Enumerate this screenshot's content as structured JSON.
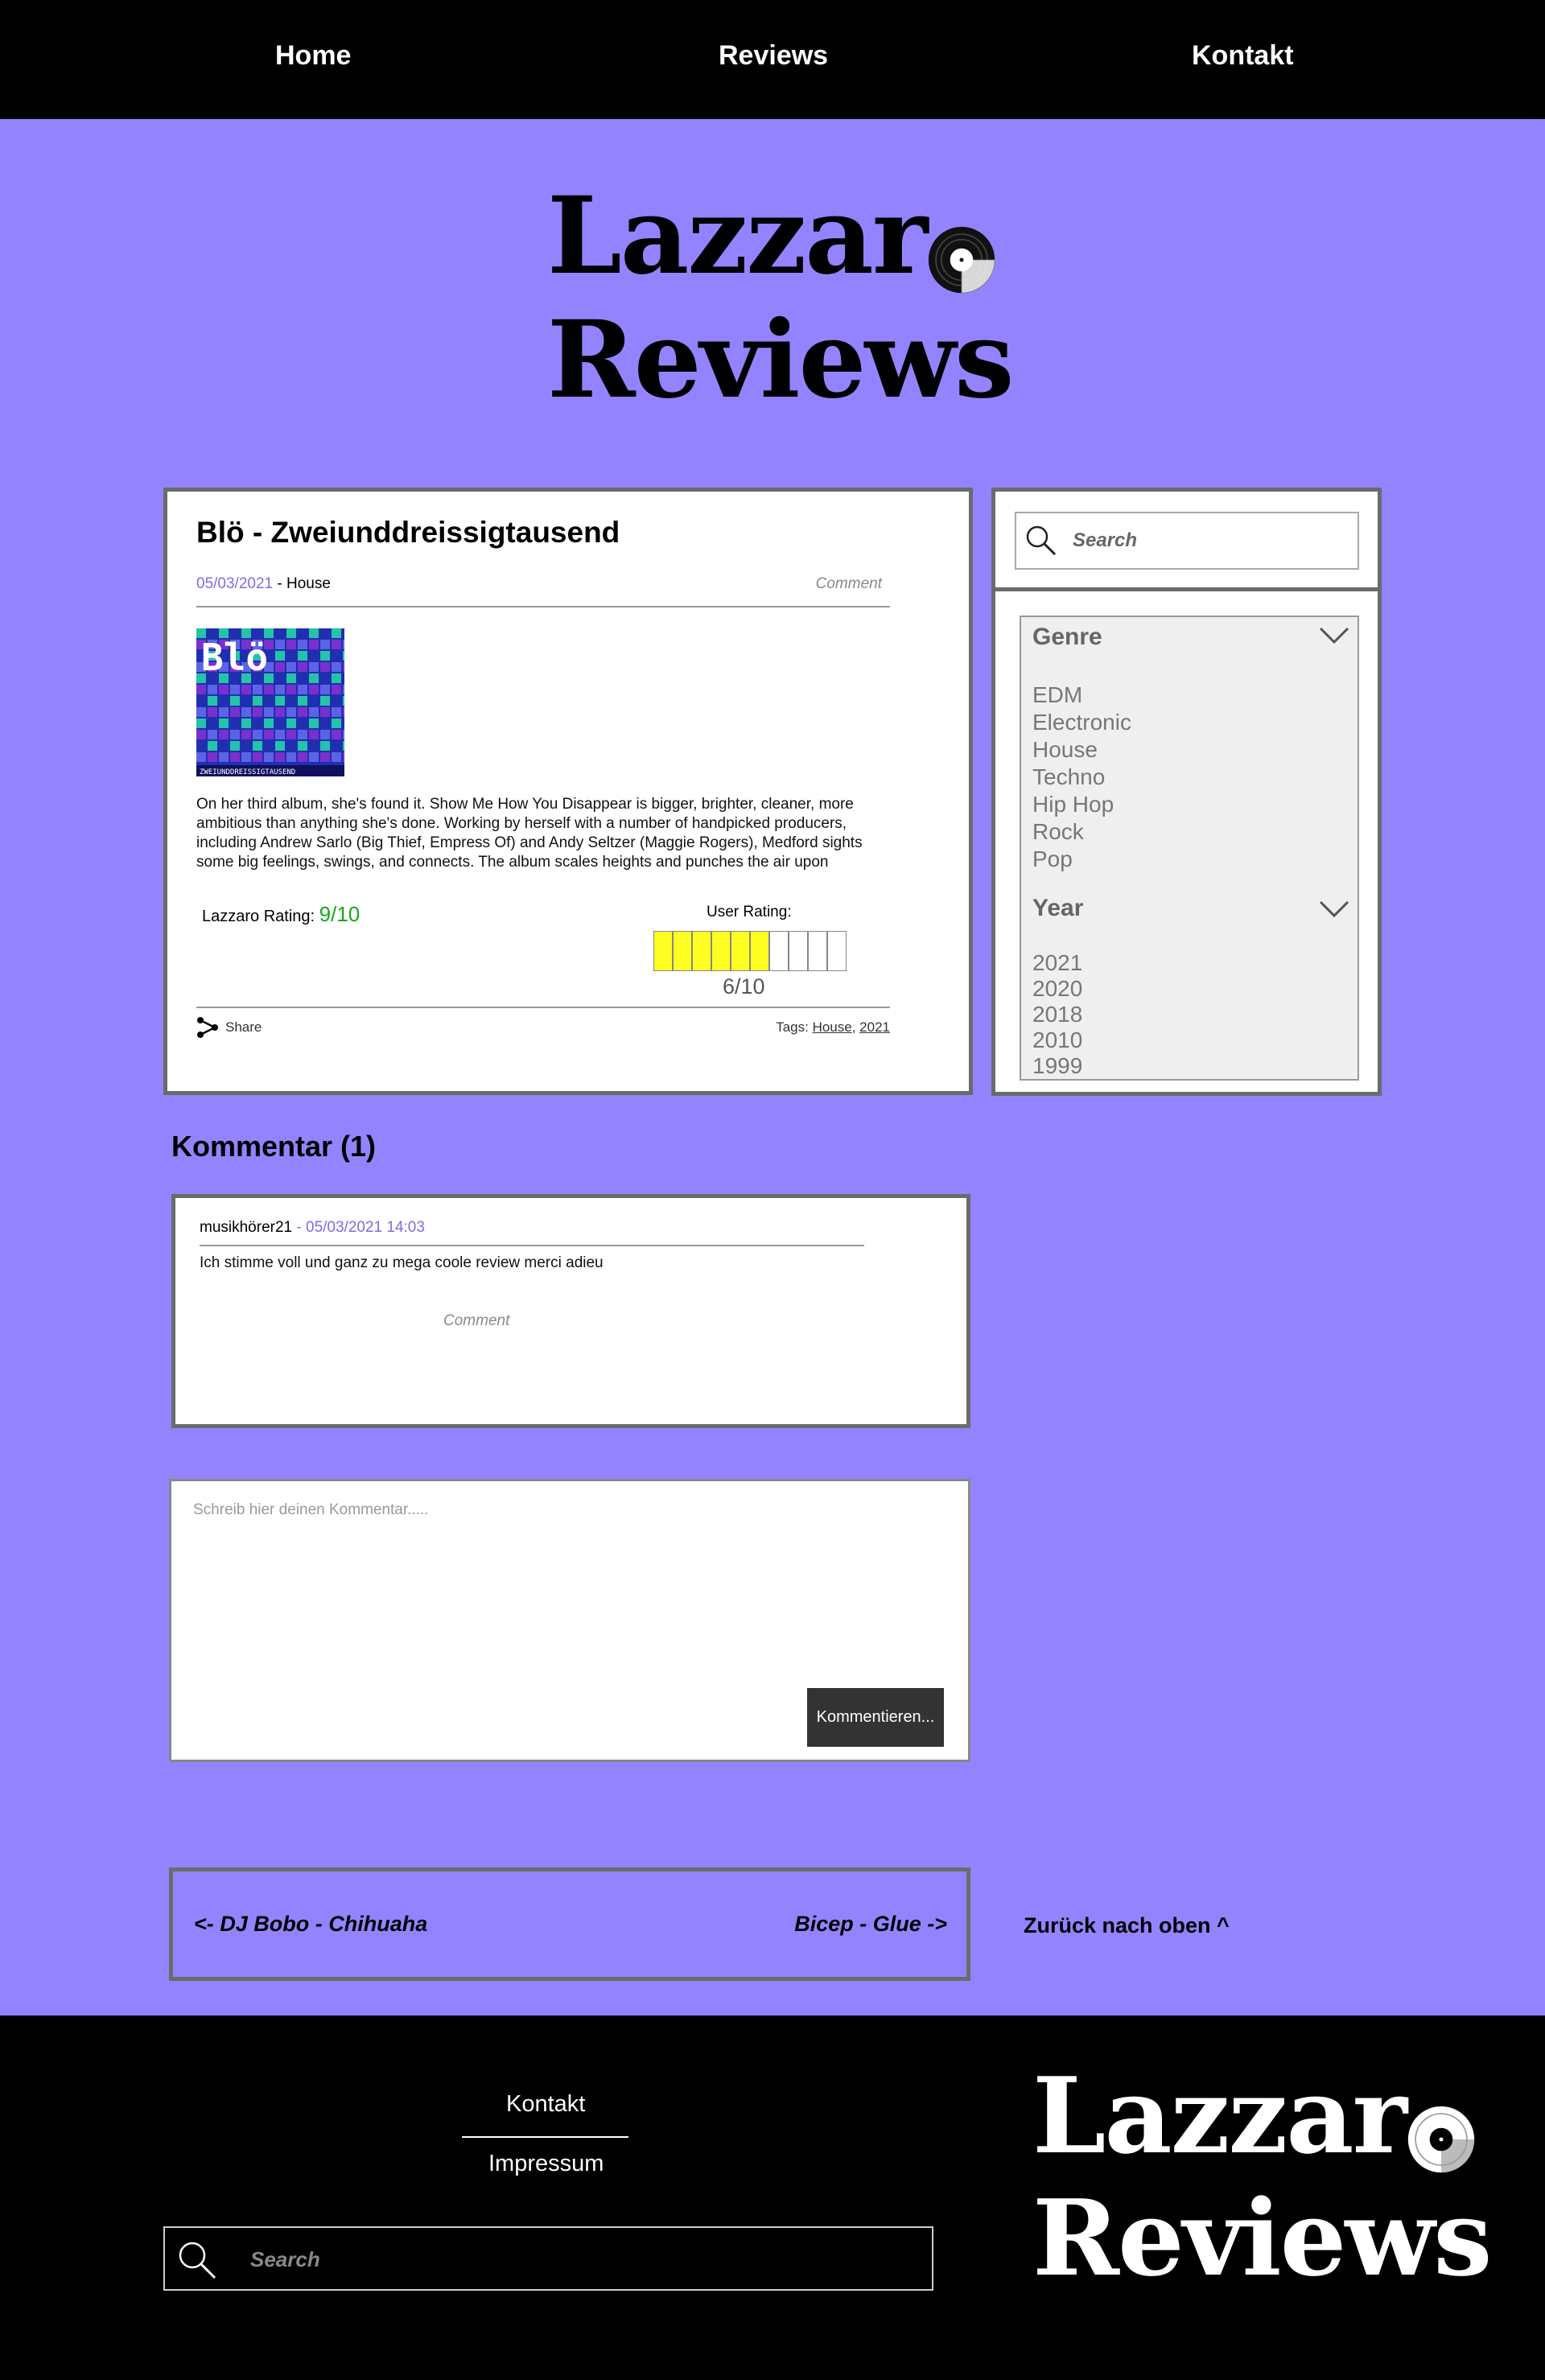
{
  "nav": {
    "home": "Home",
    "reviews": "Reviews",
    "kontakt": "Kontakt"
  },
  "logo": {
    "line1": "Lazzar",
    "line2": "Reviews"
  },
  "article": {
    "title": "Blö - Zweiunddreissigtausend",
    "date": "05/03/2021",
    "genre": " - House",
    "comment_link": "Comment",
    "cover_title": "Blö",
    "cover_caption": "ZWEIUNDDREISSIGTAUSEND",
    "body": "On her third album, she's found it. Show Me How You Disappear is bigger, brighter, cleaner, more ambitious than anything she's done. Working by herself with a number of handpicked producers, including Andrew Sarlo (Big Thief, Empress Of) and Andy Seltzer (Maggie Rogers), Medford sights some big feelings, swings, and connects. The album scales heights and punches the air upon",
    "lazzaro_label": "Lazzaro Rating: ",
    "lazzaro_score": "9/10",
    "user_label": "User Rating:",
    "user_score": "6/10",
    "user_rating_value": 6,
    "user_rating_max": 10,
    "share": "Share",
    "tags_label": "Tags: ",
    "tags": [
      "House",
      "2021"
    ]
  },
  "sidebar": {
    "search_placeholder": "Search",
    "genre_title": "Genre",
    "genres": [
      "EDM",
      "Electronic",
      "House",
      "Techno",
      "Hip Hop",
      "Rock",
      "Pop"
    ],
    "year_title": "Year",
    "years": [
      "2021",
      "2020",
      "2018",
      "2010",
      "1999"
    ]
  },
  "comments": {
    "title": "Kommentar (1)",
    "items": [
      {
        "user": "musikhörer21",
        "sep": " - ",
        "time": "05/03/2021 14:03",
        "text": "Ich stimme voll und ganz zu mega coole review merci adieu",
        "reply": "Comment"
      }
    ],
    "compose_placeholder": "Schreib hier deinen Kommentar.....",
    "submit": "Kommentieren..."
  },
  "pager": {
    "prev": "<- DJ Bobo - Chihuaha",
    "next": "Bicep - Glue ->",
    "back_top": "Zurück nach oben ^"
  },
  "footer": {
    "kontakt": "Kontakt",
    "impressum": "Impressum",
    "search_placeholder": "Search"
  },
  "colors": {
    "background": "#9483ff",
    "accent_date": "#7b6ce8",
    "lazzaro_score": "#1aa61a",
    "rating_fill": "#ffff22"
  }
}
